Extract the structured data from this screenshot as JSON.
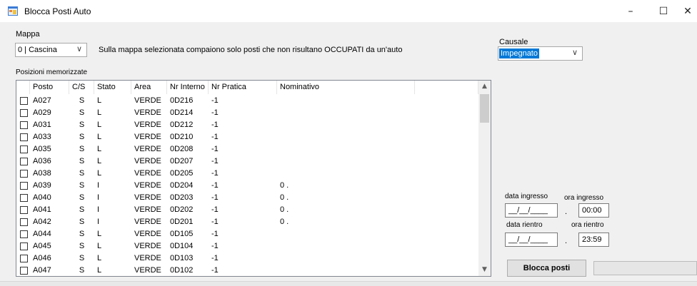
{
  "window": {
    "title": "Blocca Posti Auto",
    "minimize": "–",
    "maximize": "☐",
    "close": "✕"
  },
  "mappa": {
    "label": "Mappa",
    "selected": "0 | Cascina",
    "info": "Sulla mappa selezionata compaiono solo posti che non risultano OCCUPATI da un'auto"
  },
  "causale": {
    "label": "Causale",
    "selected": "Impegnato"
  },
  "positions": {
    "label": "Posizioni memorizzate",
    "columns": [
      "Posto",
      "C/S",
      "Stato",
      "Area",
      "Nr Interno",
      "Nr Pratica",
      "Nominativo"
    ],
    "rows": [
      {
        "posto": "A027",
        "cs": "S",
        "stato": "L",
        "area": "VERDE",
        "interno": "0D216",
        "pratica": "-1",
        "nominativo": ""
      },
      {
        "posto": "A029",
        "cs": "S",
        "stato": "L",
        "area": "VERDE",
        "interno": "0D214",
        "pratica": "-1",
        "nominativo": ""
      },
      {
        "posto": "A031",
        "cs": "S",
        "stato": "L",
        "area": "VERDE",
        "interno": "0D212",
        "pratica": "-1",
        "nominativo": ""
      },
      {
        "posto": "A033",
        "cs": "S",
        "stato": "L",
        "area": "VERDE",
        "interno": "0D210",
        "pratica": "-1",
        "nominativo": ""
      },
      {
        "posto": "A035",
        "cs": "S",
        "stato": "L",
        "area": "VERDE",
        "interno": "0D208",
        "pratica": "-1",
        "nominativo": ""
      },
      {
        "posto": "A036",
        "cs": "S",
        "stato": "L",
        "area": "VERDE",
        "interno": "0D207",
        "pratica": "-1",
        "nominativo": ""
      },
      {
        "posto": "A038",
        "cs": "S",
        "stato": "L",
        "area": "VERDE",
        "interno": "0D205",
        "pratica": "-1",
        "nominativo": ""
      },
      {
        "posto": "A039",
        "cs": "S",
        "stato": "I",
        "area": "VERDE",
        "interno": "0D204",
        "pratica": "-1",
        "nominativo": "0 ."
      },
      {
        "posto": "A040",
        "cs": "S",
        "stato": "I",
        "area": "VERDE",
        "interno": "0D203",
        "pratica": "-1",
        "nominativo": "0 ."
      },
      {
        "posto": "A041",
        "cs": "S",
        "stato": "I",
        "area": "VERDE",
        "interno": "0D202",
        "pratica": "-1",
        "nominativo": "0 ."
      },
      {
        "posto": "A042",
        "cs": "S",
        "stato": "I",
        "area": "VERDE",
        "interno": "0D201",
        "pratica": "-1",
        "nominativo": "0 ."
      },
      {
        "posto": "A044",
        "cs": "S",
        "stato": "L",
        "area": "VERDE",
        "interno": "0D105",
        "pratica": "-1",
        "nominativo": ""
      },
      {
        "posto": "A045",
        "cs": "S",
        "stato": "L",
        "area": "VERDE",
        "interno": "0D104",
        "pratica": "-1",
        "nominativo": ""
      },
      {
        "posto": "A046",
        "cs": "S",
        "stato": "L",
        "area": "VERDE",
        "interno": "0D103",
        "pratica": "-1",
        "nominativo": ""
      },
      {
        "posto": "A047",
        "cs": "S",
        "stato": "L",
        "area": "VERDE",
        "interno": "0D102",
        "pratica": "-1",
        "nominativo": ""
      }
    ]
  },
  "dates": {
    "data_ingresso_label": "data ingresso",
    "ora_ingresso_label": "ora ingresso",
    "data_ingresso_value": "__/__/____",
    "ora_ingresso_value": "00:00",
    "data_rientro_label": "data rientro",
    "ora_rientro_label": "ora rientro",
    "data_rientro_value": "__/__/____",
    "ora_rientro_value": "23:59",
    "separator": "."
  },
  "actions": {
    "blocca_label": "Blocca posti"
  },
  "icons": {
    "app": "app-window-icon",
    "combo": "chevron-down-icon",
    "scroll_up": "scroll-up-arrow-icon",
    "scroll_down": "scroll-down-arrow-icon"
  },
  "colors": {
    "selection": "#0078d7",
    "window_bg": "#f0f0f0"
  }
}
